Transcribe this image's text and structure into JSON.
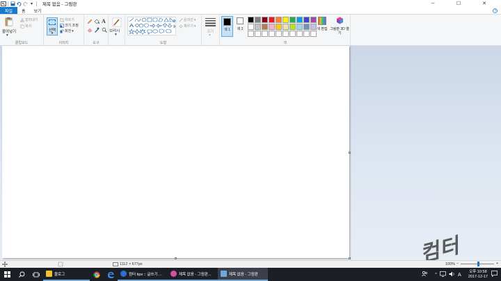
{
  "window": {
    "title": "제목 없음 - 그림판",
    "minimize": "─",
    "maximize": "☐",
    "close": "✕"
  },
  "tabs": [
    {
      "label": "파일"
    },
    {
      "label": "홈"
    },
    {
      "label": "보기"
    }
  ],
  "ribbon": {
    "clipboard": {
      "paste": "붙여넣기",
      "cut": "잘라내기",
      "copy": "복사",
      "label": "클립보드"
    },
    "image": {
      "select": "선택",
      "crop": "자르기",
      "resize": "크기 조정",
      "rotate": "회전",
      "label": "이미지"
    },
    "tools": {
      "label": "도구"
    },
    "brushes": {
      "label": "브러시"
    },
    "shapes": {
      "outline": "윤곽선",
      "fill": "채우기",
      "label": "도형"
    },
    "size": {
      "label": "크기"
    },
    "colors": {
      "color1": "색 1",
      "color2": "색 2",
      "edit": "색 편집",
      "paint3d": "그림판 3D 열기",
      "label": "색",
      "color1_value": "#000000",
      "color2_value": "#ffffff",
      "palette_row1": [
        "#000000",
        "#7f7f7f",
        "#880015",
        "#ed1c24",
        "#ff7f27",
        "#fff200",
        "#22b14c",
        "#00a2e8",
        "#3f48cc",
        "#a349a4"
      ],
      "palette_row2": [
        "#ffffff",
        "#c3c3c3",
        "#b97a57",
        "#ffaec9",
        "#ffc90e",
        "#efe4b0",
        "#b5e61d",
        "#99d9ea",
        "#7092be",
        "#c8bfe7"
      ],
      "palette_row3": [
        "#ffffff",
        "#ffffff",
        "#ffffff",
        "#ffffff",
        "#ffffff",
        "#ffffff",
        "#ffffff",
        "#ffffff",
        "#ffffff",
        "#ffffff"
      ]
    }
  },
  "watermark": "컴터 tips",
  "statusbar": {
    "canvas_size": "1112 × 677px",
    "zoom": "100%",
    "zoom_out": "−",
    "zoom_in": "+"
  },
  "taskbar": {
    "start_icon": "windows-icon",
    "apps": [
      {
        "label": "블로그",
        "color": "#f2c12e"
      },
      {
        "label": "",
        "color": "#4285f4"
      },
      {
        "label": "",
        "color": "#2a6fd6"
      },
      {
        "label": "컴터 tips :: 글쓰기 ...",
        "color": "#2a6fd6"
      },
      {
        "label": "제목 없음 - 그림판...",
        "color": "#d94fa0"
      },
      {
        "label": "제목 없음 - 그림판",
        "color": "#6fa8dc"
      }
    ],
    "clock_time": "오후 10:58",
    "clock_date": "2017-12-17"
  }
}
